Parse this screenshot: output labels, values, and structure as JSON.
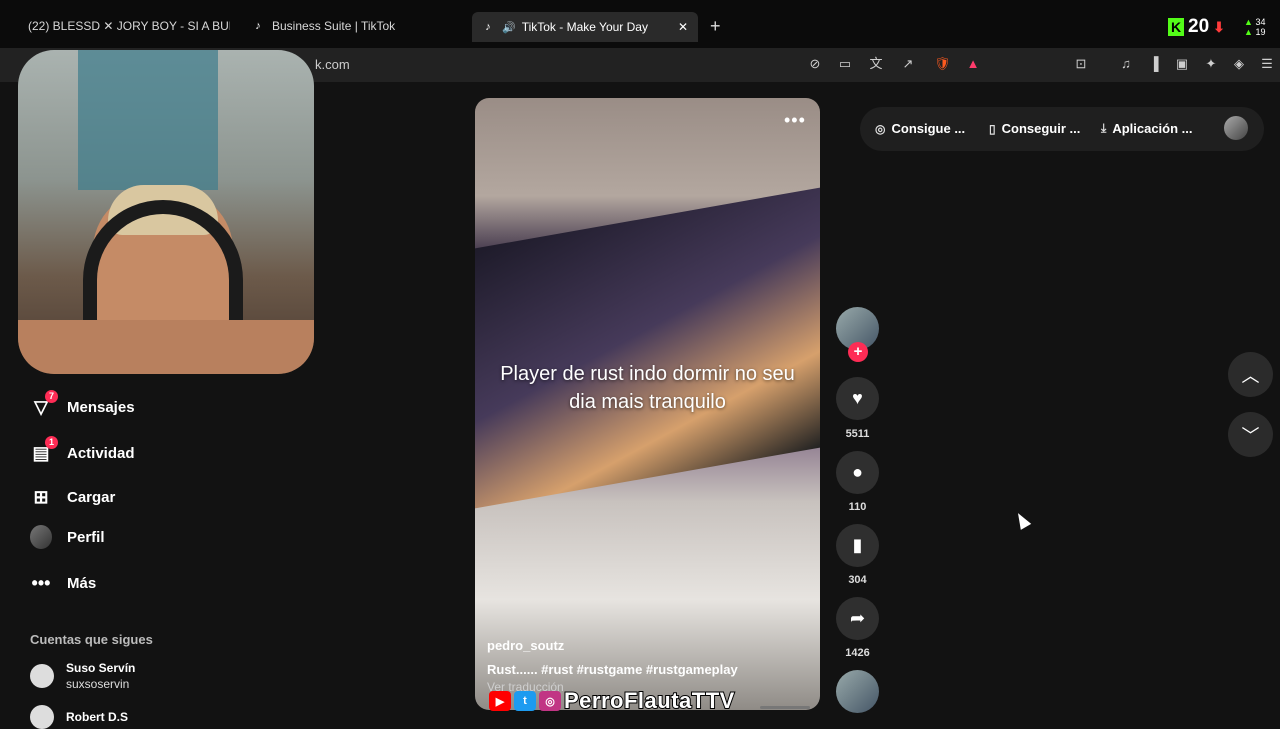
{
  "browser": {
    "tabs": [
      {
        "label": "(22) BLESSD ✕ JORY BOY - SI A BUE",
        "icon": "youtube-icon"
      },
      {
        "label": "Business Suite | TikTok",
        "icon": "tiktok-icon"
      },
      {
        "label": "TikTok - Make Your Day",
        "icon": "tiktok-icon",
        "active": true
      }
    ],
    "new_tab": "+",
    "close": "✕",
    "url": "k.com",
    "kick": {
      "logo": "K",
      "count": "20",
      "stat_top": "34",
      "stat_bottom": "19"
    },
    "accent": "#53fc18"
  },
  "sidebar": {
    "items": [
      {
        "label": "Mensajes",
        "icon": "send-icon",
        "badge": "7"
      },
      {
        "label": "Actividad",
        "icon": "inbox-icon",
        "badge": "1"
      },
      {
        "label": "Cargar",
        "icon": "upload-icon"
      },
      {
        "label": "Perfil",
        "icon": "avatar"
      },
      {
        "label": "Más",
        "icon": "more-icon"
      }
    ],
    "following_title": "Cuentas que sigues",
    "following": [
      {
        "name": "Suso Servín",
        "username": "suxsoservin"
      },
      {
        "name": "Robert D.S",
        "username": ""
      }
    ]
  },
  "video": {
    "overlay_text": "Player de rust indo dormir no seu dia mais tranquilo",
    "author": "pedro_soutz",
    "description": "Rust...... #rust #rustgame #rustgameplay",
    "translate": "Ver traducción",
    "menu": "•••"
  },
  "actions": {
    "likes": "5511",
    "comments": "110",
    "saves": "304",
    "shares": "1426"
  },
  "header_right": {
    "coins": "Consigue ...",
    "app": "Conseguir ...",
    "download": "Aplicación ..."
  },
  "watermark": {
    "text": "PerroFlautaTTV"
  },
  "colors": {
    "tiktok_red": "#fe2c55",
    "background": "#121212"
  }
}
